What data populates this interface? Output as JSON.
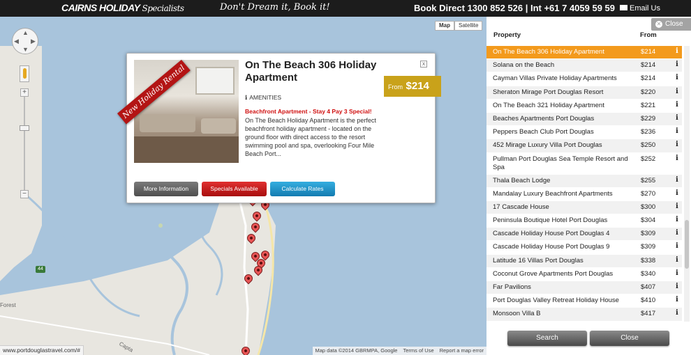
{
  "header": {
    "brand": "CAIRNS HOLIDAY",
    "brand_suffix": "Specialists",
    "tagline": "Don't Dream it, Book it!",
    "book": "Book Direct 1300 852 526 | Int +61 7 4059 59 59",
    "email": "Email Us"
  },
  "map": {
    "type_map": "Map",
    "type_satellite": "Satellite",
    "highway": "44",
    "label_forest": "Forest",
    "label_captain": "Capta",
    "attribution": "Map data ©2014 GBRMPA, Google",
    "terms": "Terms of Use",
    "report": "Report a map error",
    "status_url": "www.portdouglastravel.com/#"
  },
  "popup": {
    "ribbon": "New Holiday Rental",
    "title": "On The Beach 306 Holiday Apartment",
    "from_label": "From",
    "price": "$214",
    "amenities": "AMENITIES",
    "special_line": "Beachfront Apartment - Stay 4 Pay 3 Special!",
    "description": "On The Beach Holiday Apartment is the perfect beachfront holiday apartment - located on the ground floor with direct access to the resort swimming pool and spa, overlooking Four Mile Beach Port...",
    "btn_more": "More Information",
    "btn_specials": "Specials Available",
    "btn_rates": "Calculate Rates",
    "close": "x"
  },
  "panel": {
    "close": "Close",
    "col_property": "Property",
    "col_from": "From",
    "rows": [
      {
        "name": "On The Beach 306 Holiday Apartment",
        "price": "$214"
      },
      {
        "name": "Solana on the Beach",
        "price": "$214"
      },
      {
        "name": "Cayman Villas Private Holiday Apartments",
        "price": "$214"
      },
      {
        "name": "Sheraton Mirage Port Douglas Resort",
        "price": "$220"
      },
      {
        "name": "On The Beach 321 Holiday Apartment",
        "price": "$221"
      },
      {
        "name": "Beaches Apartments Port Douglas",
        "price": "$229"
      },
      {
        "name": "Peppers Beach Club Port Douglas",
        "price": "$236"
      },
      {
        "name": "452 Mirage Luxury Villa Port Douglas",
        "price": "$250"
      },
      {
        "name": "Pullman Port Douglas Sea Temple Resort and Spa",
        "price": "$252"
      },
      {
        "name": "Thala Beach Lodge",
        "price": "$255"
      },
      {
        "name": "Mandalay Luxury Beachfront Apartments",
        "price": "$270"
      },
      {
        "name": "17 Cascade House",
        "price": "$300"
      },
      {
        "name": "Peninsula Boutique Hotel Port Douglas",
        "price": "$304"
      },
      {
        "name": "Cascade Holiday House Port Douglas 4",
        "price": "$309"
      },
      {
        "name": "Cascade Holiday House Port Douglas 9",
        "price": "$309"
      },
      {
        "name": "Latitude 16 Villas Port Douglas",
        "price": "$338"
      },
      {
        "name": "Coconut Grove Apartments Port Douglas",
        "price": "$340"
      },
      {
        "name": "Far Pavilions",
        "price": "$407"
      },
      {
        "name": "Port Douglas Valley Retreat Holiday House",
        "price": "$410"
      },
      {
        "name": "Monsoon Villa B",
        "price": "$417"
      }
    ],
    "info_icon": "i",
    "search_button": "Search",
    "close_button": "Close"
  },
  "colors": {
    "selected_row": "#f39a1c",
    "price_badge": "#c9a21a",
    "specials_button": "#c41818",
    "rates_button": "#1f90c8"
  }
}
